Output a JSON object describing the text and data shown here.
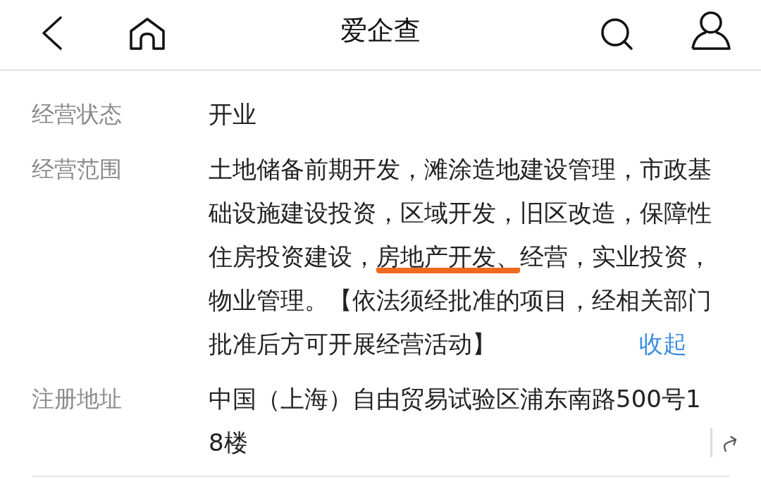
{
  "header": {
    "title": "爱企查"
  },
  "fields": [
    {
      "label": "经营状态",
      "kind": "plain",
      "segments": [
        {
          "text": "开业",
          "highlighted": false
        }
      ]
    },
    {
      "label": "经营范围",
      "kind": "collapsible",
      "segments": [
        {
          "text": "土地储备前期开发，滩涂造地建设管理，市政基础设施建设投资，区域开发，旧区改造，保障性住房投资建设，",
          "highlighted": false
        },
        {
          "text": "房地产开发、",
          "highlighted": true
        },
        {
          "text": "经营，实业投资，物业管理。【依法须经批准的项目，经相关部门批准后方可开展经营活动】",
          "highlighted": false
        }
      ],
      "toggle": "收起"
    },
    {
      "label": "注册地址",
      "kind": "address",
      "segments": [
        {
          "text": "中国（上海）自由贸易试验区浦东南路500号18楼",
          "highlighted": false
        }
      ]
    }
  ]
}
